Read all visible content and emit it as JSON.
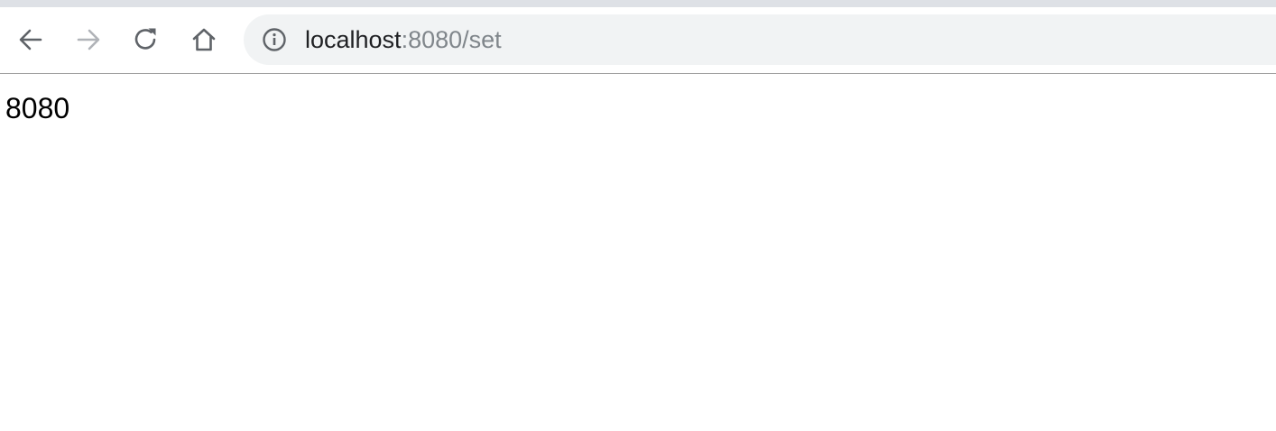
{
  "browser": {
    "url_host": "localhost",
    "url_rest": ":8080/set",
    "icons": {
      "back": "arrow-left-icon",
      "forward": "arrow-right-icon",
      "reload": "reload-icon",
      "home": "home-icon",
      "site_info": "info-icon"
    },
    "colors": {
      "tabstrip": "#dee1e6",
      "omnibox_bg": "#f1f3f4",
      "icon_active": "#5f6368",
      "icon_disabled": "#b0b3b8",
      "url_host": "#202124",
      "url_rest": "#80868b"
    }
  },
  "page": {
    "body_text": "8080"
  }
}
